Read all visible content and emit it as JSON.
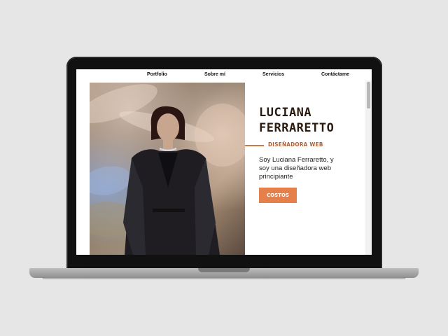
{
  "nav": {
    "items": [
      {
        "label": "Portfolio"
      },
      {
        "label": "Sobre mí"
      },
      {
        "label": "Servicios"
      },
      {
        "label": "Contáctame"
      }
    ]
  },
  "hero": {
    "name": "LUCIANA FERRARETTO",
    "role": "DISEÑADORA WEB",
    "description": "Soy Luciana Ferraretto, y soy una diseñadora web principiante",
    "cta_label": "COSTOS"
  },
  "colors": {
    "accent": "#e5804a",
    "role_text": "#b05e2e",
    "title_text": "#2a1a10",
    "page_background": "#e6e6e6"
  }
}
